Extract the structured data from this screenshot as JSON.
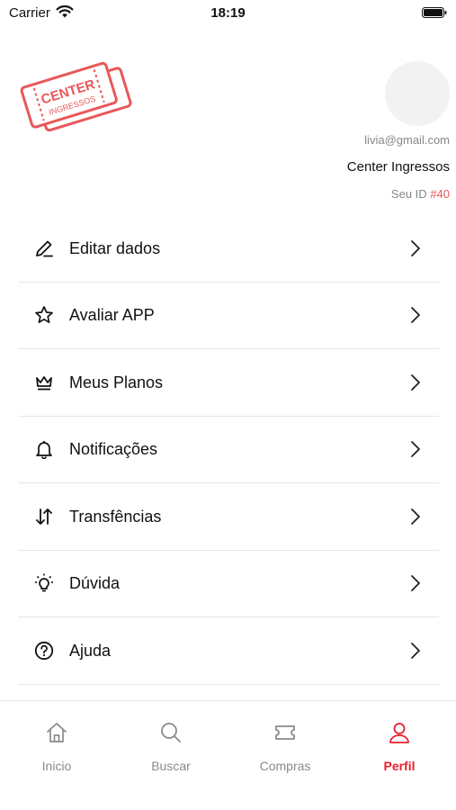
{
  "status_bar": {
    "carrier": "Carrier",
    "time": "18:19"
  },
  "brand": {
    "logo_line1": "CENTER",
    "logo_line2": "INGRESSOS",
    "accent_color": "#e8585a"
  },
  "profile": {
    "email": "livia@gmail.com",
    "name": "Center Ingressos",
    "id_label": "Seu ID",
    "id_value": "#40"
  },
  "menu": [
    {
      "label": "Editar dados",
      "icon": "edit-icon"
    },
    {
      "label": "Avaliar APP",
      "icon": "star-icon"
    },
    {
      "label": "Meus Planos",
      "icon": "crown-icon"
    },
    {
      "label": "Notificações",
      "icon": "bell-icon"
    },
    {
      "label": "Transfências",
      "icon": "transfer-icon"
    },
    {
      "label": "Dúvida",
      "icon": "lightbulb-icon"
    },
    {
      "label": "Ajuda",
      "icon": "help-icon"
    }
  ],
  "tabs": [
    {
      "label": "Inicio",
      "icon": "home-icon",
      "active": false
    },
    {
      "label": "Buscar",
      "icon": "search-icon",
      "active": false
    },
    {
      "label": "Compras",
      "icon": "ticket-icon",
      "active": false
    },
    {
      "label": "Perfil",
      "icon": "user-icon",
      "active": true
    }
  ],
  "colors": {
    "active_tab": "#e8202a",
    "inactive_tab": "#8a8a8a"
  }
}
